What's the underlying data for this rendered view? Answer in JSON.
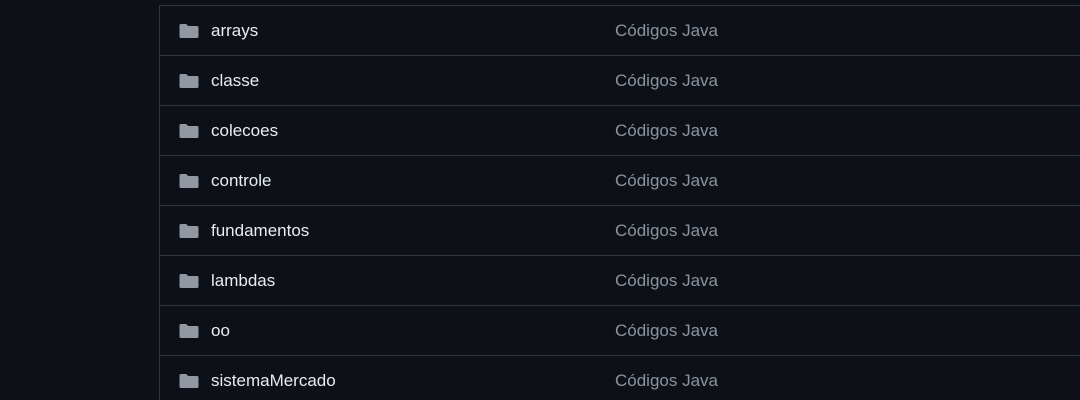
{
  "file_list": {
    "rows": [
      {
        "icon": "folder-icon",
        "name": "arrays",
        "commit_message": "Códigos Java"
      },
      {
        "icon": "folder-icon",
        "name": "classe",
        "commit_message": "Códigos Java"
      },
      {
        "icon": "folder-icon",
        "name": "colecoes",
        "commit_message": "Códigos Java"
      },
      {
        "icon": "folder-icon",
        "name": "controle",
        "commit_message": "Códigos Java"
      },
      {
        "icon": "folder-icon",
        "name": "fundamentos",
        "commit_message": "Códigos Java"
      },
      {
        "icon": "folder-icon",
        "name": "lambdas",
        "commit_message": "Códigos Java"
      },
      {
        "icon": "folder-icon",
        "name": "oo",
        "commit_message": "Códigos Java"
      },
      {
        "icon": "folder-icon",
        "name": "sistemaMercado",
        "commit_message": "Códigos Java"
      }
    ]
  },
  "colors": {
    "background": "#0d1117",
    "border": "#30363d",
    "folder_icon": "#9198a1",
    "name_text": "#e6edf3",
    "message_text": "#8b949e"
  }
}
